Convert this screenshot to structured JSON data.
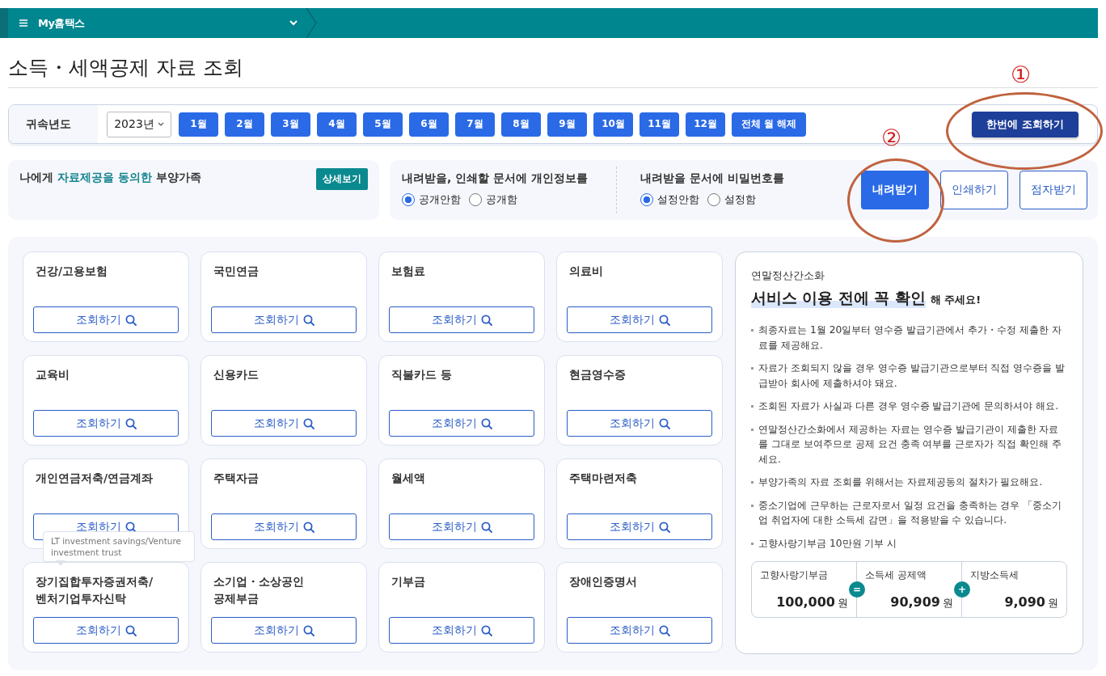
{
  "nav": {
    "title": "My홈택스"
  },
  "page_title": "소득・세액공제 자료 조회",
  "filter": {
    "label": "귀속년도",
    "year": "2023년",
    "months": [
      {
        "label": "1월"
      },
      {
        "label": "2월"
      },
      {
        "label": "3월"
      },
      {
        "label": "4월"
      },
      {
        "label": "5월"
      },
      {
        "label": "6월"
      },
      {
        "label": "7월"
      },
      {
        "label": "8월"
      },
      {
        "label": "9월"
      },
      {
        "label": "10월"
      },
      {
        "label": "11월"
      },
      {
        "label": "12월"
      }
    ],
    "clear_button": "전체 월 해제",
    "query_all_button": "한번에 조회하기"
  },
  "dependents": {
    "text": "나에게 **자료제공을 동의한** 부양가족",
    "detail_button": "상세보기"
  },
  "options": [
    {
      "label": "내려받을, 인쇄할 문서에 개인정보를",
      "choices": [
        {
          "label": "공개안함",
          "selected": true
        },
        {
          "label": "공개함",
          "selected": false
        }
      ]
    },
    {
      "label": "내려받을 문서에 비밀번호를",
      "choices": [
        {
          "label": "설정안함",
          "selected": true
        },
        {
          "label": "설정함",
          "selected": false
        }
      ]
    }
  ],
  "actions": [
    {
      "label": "내려받기",
      "kind": "primary"
    },
    {
      "label": "인쇄하기",
      "kind": "outline"
    },
    {
      "label": "점자받기",
      "kind": "outline"
    }
  ],
  "categories": [
    {
      "title": "건강/고용보험",
      "button": "조회하기"
    },
    {
      "title": "국민연금",
      "button": "조회하기"
    },
    {
      "title": "보험료",
      "button": "조회하기"
    },
    {
      "title": "의료비",
      "button": "조회하기"
    },
    {
      "title": "교육비",
      "button": "조회하기"
    },
    {
      "title": "신용카드",
      "button": "조회하기"
    },
    {
      "title": "직불카드 등",
      "button": "조회하기"
    },
    {
      "title": "현금영수증",
      "button": "조회하기"
    },
    {
      "title": "개인연금저축/연금계좌",
      "button": "조회하기"
    },
    {
      "title": "주택자금",
      "button": "조회하기"
    },
    {
      "title": "월세액",
      "button": "조회하기"
    },
    {
      "title": "주택마련저축",
      "button": "조회하기"
    },
    {
      "title": "장기집합투자증권저축/\n벤처기업투자신탁",
      "button": "조회하기"
    },
    {
      "title": "소기업・소상공인\n공제부금",
      "button": "조회하기"
    },
    {
      "title": "기부금",
      "button": "조회하기"
    },
    {
      "title": "장애인증명서",
      "button": "조회하기"
    }
  ],
  "tooltip": "LT investment savings/Venture investment trust",
  "info": {
    "eyebrow": "연말정산간소화",
    "headline": "서비스 이용 전에 꼭 확인",
    "headline_suffix": "해 주세요!",
    "notes": [
      "최종자료는 1월 20일부터 영수증 발급기관에서 추가・수정 제출한 자료를 제공해요.",
      "자료가 조회되지 않을 경우 영수증 발급기관으로부터 직접 영수증을 발급받아 회사에 제출하셔야 돼요.",
      "조회된 자료가 사실과 다른 경우 영수증 발급기관에 문의하셔야 해요.",
      "연말정산간소화에서 제공하는 자료는 영수증 발급기관이 제출한 자료를 그대로 보여주므로 공제 요건 충족 여부를 근로자가 직접 확인해 주세요.",
      "부양가족의 자료 조회를 위해서는 자료제공동의 절차가 필요해요.",
      "중소기업에 근무하는 근로자로서 일정 요건을 충족하는 경우 「중소기업 취업자에 대한 소득세 감면」을 적용받을 수 있습니다.",
      "고향사랑기부금 10만원 기부 시"
    ],
    "calc": [
      {
        "label": "고향사랑기부금",
        "amount": "100,000",
        "unit": "원"
      },
      {
        "label": "소득세 공제액",
        "amount": "90,909",
        "unit": "원",
        "operator": "="
      },
      {
        "label": "지방소득세",
        "amount": "9,090",
        "unit": "원",
        "operator": "+"
      }
    ]
  },
  "annotations": [
    {
      "label": "①"
    },
    {
      "label": "②"
    }
  ]
}
